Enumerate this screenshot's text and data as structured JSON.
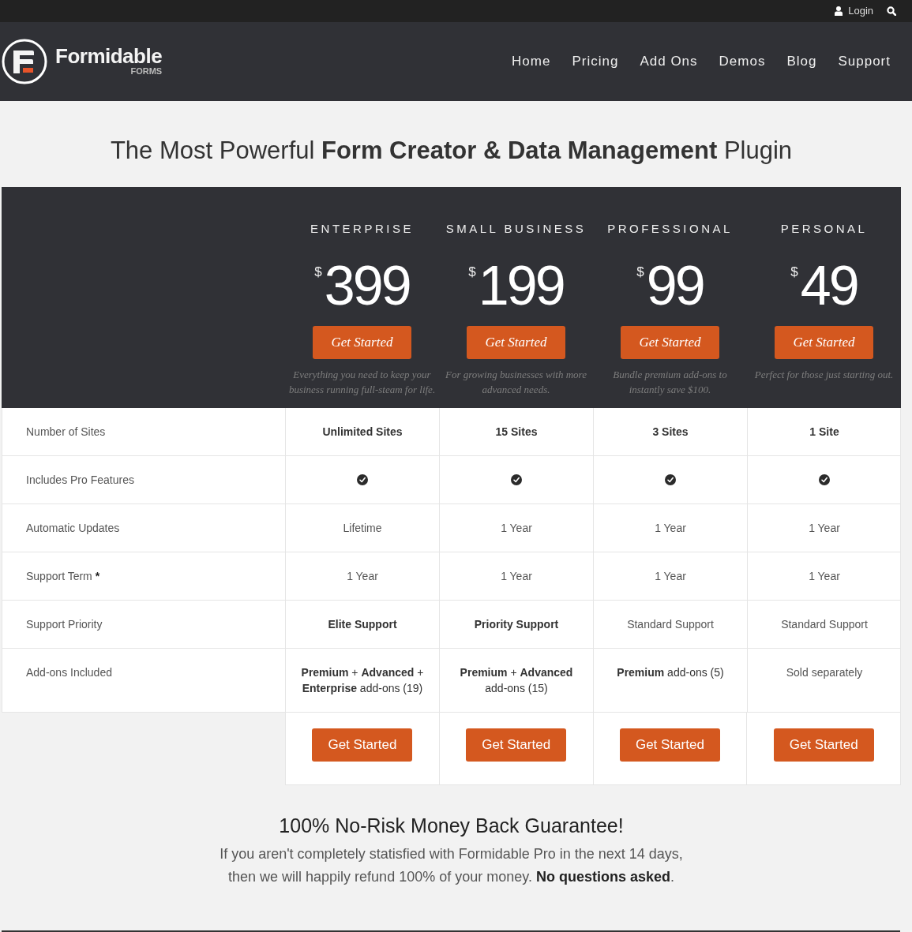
{
  "top_bar": {
    "login": "Login"
  },
  "nav": {
    "brand": "Formidable",
    "brand_sub": "FORMS",
    "links": [
      "Home",
      "Pricing",
      "Add Ons",
      "Demos",
      "Blog",
      "Support"
    ]
  },
  "headline": "The Most Powerful **Form Creator & Data Management** Plugin",
  "plans": [
    {
      "name": "ENTERPRISE",
      "currency": "$",
      "price": "399",
      "button": "Get Started",
      "description": "Everything you need to keep your business running full-steam for life."
    },
    {
      "name": "SMALL BUSINESS",
      "currency": "$",
      "price": "199",
      "button": "Get Started",
      "description": "For growing businesses with more advanced needs."
    },
    {
      "name": "PROFESSIONAL",
      "currency": "$",
      "price": "99",
      "button": "Get Started",
      "description": "Bundle premium add-ons to instantly save $100."
    },
    {
      "name": "PERSONAL",
      "currency": "$",
      "price": "49",
      "button": "Get Started",
      "description": "Perfect for those just starting out."
    }
  ],
  "features": [
    {
      "label": "Number of Sites",
      "cells": [
        {
          "kind": "strong",
          "text": "Unlimited Sites"
        },
        {
          "kind": "strong",
          "text": "15 Sites"
        },
        {
          "kind": "strong",
          "text": "3 Sites"
        },
        {
          "kind": "strong",
          "text": "1 Site"
        }
      ]
    },
    {
      "label": "Includes Pro Features",
      "cells": [
        {
          "kind": "check",
          "checked": true
        },
        {
          "kind": "check",
          "checked": true
        },
        {
          "kind": "check",
          "checked": true
        },
        {
          "kind": "check",
          "checked": true
        }
      ]
    },
    {
      "label": "Automatic Updates",
      "cells": [
        {
          "kind": "plain",
          "text": "Lifetime"
        },
        {
          "kind": "plain",
          "text": "1 Year"
        },
        {
          "kind": "plain",
          "text": "1 Year"
        },
        {
          "kind": "plain",
          "text": "1 Year"
        }
      ]
    },
    {
      "label": "Support Term",
      "mark": "*",
      "cells": [
        {
          "kind": "plain",
          "text": "1 Year"
        },
        {
          "kind": "plain",
          "text": "1 Year"
        },
        {
          "kind": "plain",
          "text": "1 Year"
        },
        {
          "kind": "plain",
          "text": "1 Year"
        }
      ]
    },
    {
      "label": "Support Priority",
      "cells": [
        {
          "kind": "strong",
          "text": "Elite Support"
        },
        {
          "kind": "strong",
          "text": "Priority Support"
        },
        {
          "kind": "plain",
          "text": "Standard Support"
        },
        {
          "kind": "plain",
          "text": "Standard Support"
        }
      ]
    },
    {
      "label": "Add-ons Included",
      "cells": [
        {
          "kind": "rich",
          "text": "**Premium** + **Advanced** + **Enterprise** add-ons (19)"
        },
        {
          "kind": "rich",
          "text": "**Premium** + **Advanced** add-ons (15)"
        },
        {
          "kind": "rich",
          "text": "**Premium** add-ons (5)"
        },
        {
          "kind": "plain",
          "text": "Sold separately"
        }
      ]
    }
  ],
  "bottom_buttons": [
    "Get Started",
    "Get Started",
    "Get Started",
    "Get Started"
  ],
  "guarantee": {
    "title": "100% No-Risk Money Back Guarantee!",
    "text": "If you aren't completely statisfied with Formidable Pro in the next 14 days, then we will happily refund 100% of your money. **No questions asked**."
  }
}
